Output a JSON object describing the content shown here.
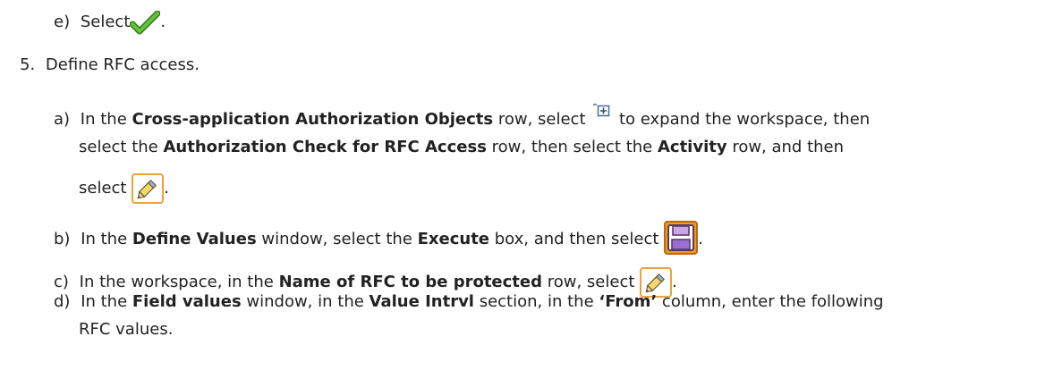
{
  "step_e_prev": {
    "marker": "e)",
    "text": "Select",
    "period": ".",
    "icon": "green-check-icon"
  },
  "step5": {
    "marker": "5.",
    "text": "Define RFC access."
  },
  "sub_a": {
    "marker": "a)",
    "t1": "In the ",
    "b1": "Cross-application Authorization Objects",
    "t2": " row, select ",
    "t3": " to expand the workspace, then",
    "l2_t1": "select the ",
    "b2": "Authorization Check for RFC Access",
    "l2_t2": " row, then select the ",
    "b3": "Activity",
    "l2_t3": " row, and then",
    "l3_t1": "select ",
    "period": ".",
    "icons": [
      "expand-icon",
      "pencil-icon"
    ]
  },
  "sub_b": {
    "marker": "b)",
    "t1": "In the ",
    "b1": "Define Values",
    "t2": " window, select the ",
    "b2": "Execute",
    "t3": " box, and then select ",
    "period": ".",
    "icon": "save-icon"
  },
  "sub_c": {
    "marker": "c)",
    "t1": "In the workspace, in the ",
    "b1": "Name of RFC to be protected",
    "t2": " row, select ",
    "period": ".",
    "icon": "pencil-icon"
  },
  "sub_d": {
    "marker": "d)",
    "t1": "In the ",
    "b1": "Field values",
    "t2": " window, in the ",
    "b2": "Value Intrvl",
    "t3": " section, in the ",
    "b3": "‘From’",
    "t4": " column, enter the following",
    "l2": "RFC values."
  },
  "colors": {
    "text": "#222222",
    "check_green": "#3aa12b",
    "pencil_frame": "#e8a33a",
    "save_orange": "#f09a1e"
  }
}
